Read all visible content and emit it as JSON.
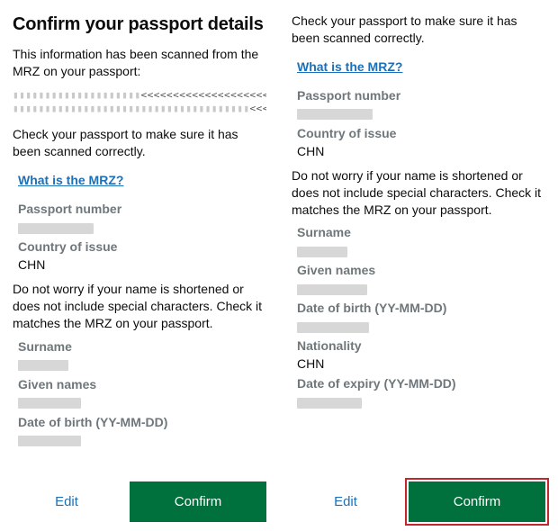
{
  "heading": "Confirm your passport details",
  "intro": "This information has been scanned from the MRZ on your passport:",
  "mrz_mask_line1_blur": "▮▮▮▮▮▮▮▮▮▮▮▮▮▮▮▮▮▮▮▮",
  "mrz_mask_line1_chev": "<<<<<<<<<<<<<<<<<<<<<<<<",
  "mrz_mask_line2_blur": "▮▮▮▮▮▮▮▮▮▮▮▮▮▮▮▮▮▮▮▮▮▮▮▮▮▮▮▮▮▮▮▮▮▮▮▮▮",
  "mrz_mask_line2_chev": "<<<<<<",
  "mrz_mask_line2_tail": "▮▮",
  "check_text": "Check your passport to make sure it has been scanned correctly.",
  "mrz_link": "What is the MRZ?",
  "fields": {
    "passport_number": {
      "label": "Passport number"
    },
    "country_of_issue": {
      "label": "Country of issue",
      "value": "CHN"
    },
    "surname": {
      "label": "Surname"
    },
    "given_names": {
      "label": "Given names"
    },
    "dob": {
      "label": "Date of birth (YY-MM-DD)"
    },
    "nationality": {
      "label": "Nationality",
      "value": "CHN"
    },
    "expiry": {
      "label": "Date of expiry (YY-MM-DD)"
    }
  },
  "name_note": "Do not worry if your name is shortened or does not include special characters. Check it matches the MRZ on your passport.",
  "buttons": {
    "edit": "Edit",
    "confirm": "Confirm"
  }
}
